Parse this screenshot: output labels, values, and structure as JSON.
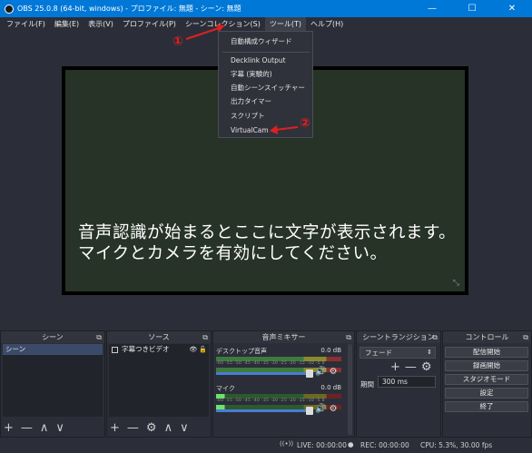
{
  "window": {
    "title": "OBS 25.0.8 (64-bit, windows) - プロファイル: 無題 - シーン: 無題",
    "minimize": "—",
    "maximize": "☐",
    "close": "✕"
  },
  "menu": [
    {
      "label": "ファイル(F)"
    },
    {
      "label": "編集(E)"
    },
    {
      "label": "表示(V)"
    },
    {
      "label": "プロファイル(P)"
    },
    {
      "label": "シーンコレクション(S)"
    },
    {
      "label": "ツール(T)"
    },
    {
      "label": "ヘルプ(H)"
    }
  ],
  "tools_menu": {
    "items": [
      "自動構成ウィザード",
      "Decklink Output",
      "字幕 (実験的)",
      "自動シーンスイッチャー",
      "出力タイマー",
      "スクリプト",
      "VirtualCam"
    ]
  },
  "annotations": {
    "one": "①",
    "two": "②"
  },
  "preview": {
    "caption": "音声認識が始まるとここに文字が表示されます。マイクとカメラを有効にしてください。",
    "corner": "⤡"
  },
  "docks": {
    "scenes": {
      "title": "シーン",
      "items": [
        "シーン"
      ]
    },
    "sources": {
      "title": "ソース",
      "items": [
        "字幕つきビデオ"
      ]
    },
    "mixer": {
      "title": "音声ミキサー",
      "channels": [
        {
          "name": "デスクトップ音声",
          "level": "0.0 dB"
        },
        {
          "name": "マイク",
          "level": "0.0 dB"
        }
      ],
      "ticks": "-60 -55 -50 -45 -40 -35 -30 -25 -20 -15 -10 -5 0"
    },
    "transitions": {
      "title": "シーントランジション",
      "selected": "フェード",
      "duration_label": "期間",
      "duration": "300 ms"
    },
    "controls": {
      "title": "コントロール",
      "buttons": [
        "配信開始",
        "録画開始",
        "スタジオモード",
        "設定",
        "終了"
      ]
    }
  },
  "status": {
    "live": "LIVE: 00:00:00",
    "rec": "REC: 00:00:00",
    "cpu": "CPU: 5.3%, 30.00 fps"
  },
  "icons": {
    "add": "+",
    "remove": "—",
    "up": "∧",
    "down": "∨",
    "gear": "⚙",
    "eye": "👁",
    "lock": "🔓",
    "speaker": "🔊",
    "popout": "⧉",
    "select_arrow": "⇕"
  },
  "colors": {
    "titlebar": "#0078d7",
    "background": "#2b2e38",
    "annotation": "#e02020",
    "selection": "#3c4a6a"
  }
}
